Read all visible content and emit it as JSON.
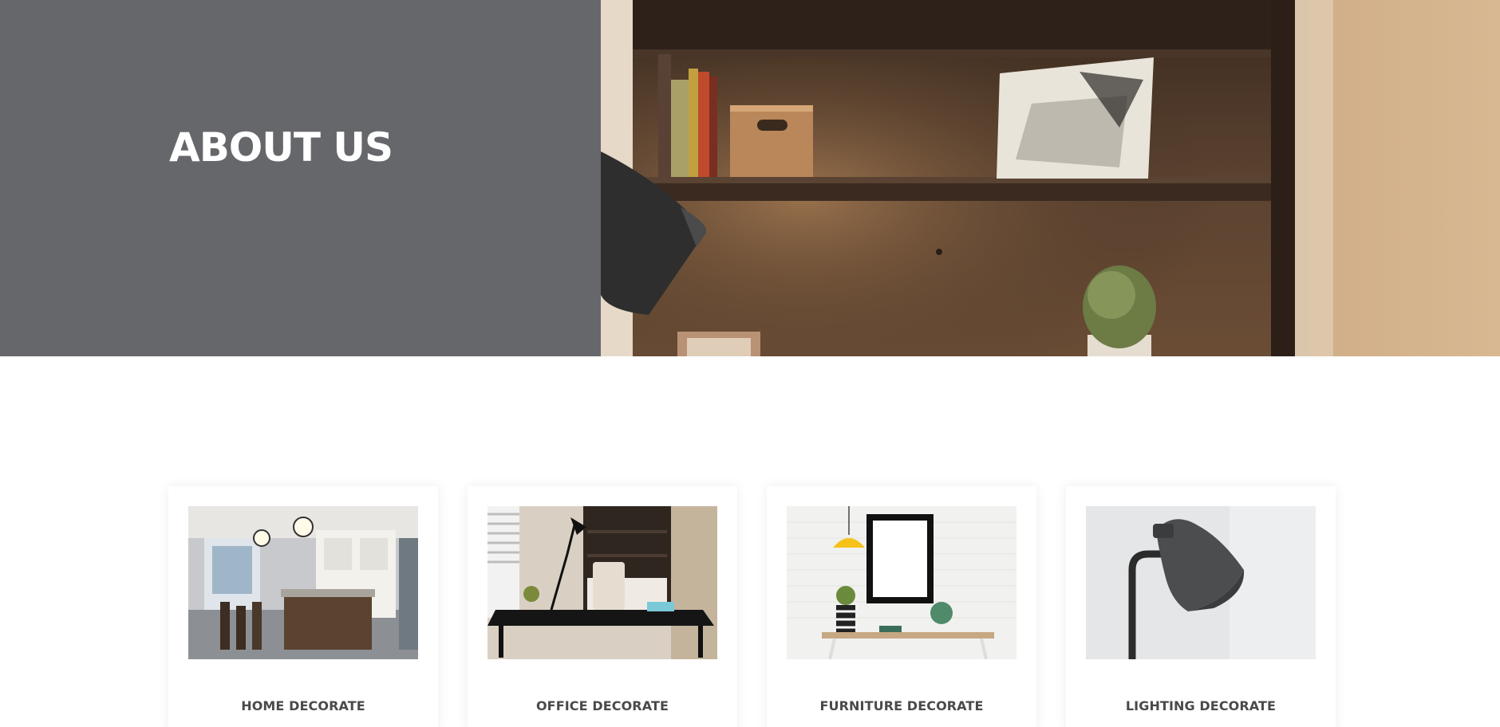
{
  "hero": {
    "title": "ABOUT US",
    "panel_color": "#66676b",
    "image": "bookshelf-with-lamp-photo"
  },
  "services": [
    {
      "title": "HOME DECORATE",
      "image": "kitchen-interior-photo"
    },
    {
      "title": "OFFICE DECORATE",
      "image": "office-desk-photo"
    },
    {
      "title": "FURNITURE DECORATE",
      "image": "desk-with-frame-and-pendant-lamp-photo"
    },
    {
      "title": "LIGHTING DECORATE",
      "image": "grey-wall-lamp-photo"
    }
  ],
  "colors": {
    "title_text": "#4a4a4a",
    "hero_text": "#ffffff"
  }
}
